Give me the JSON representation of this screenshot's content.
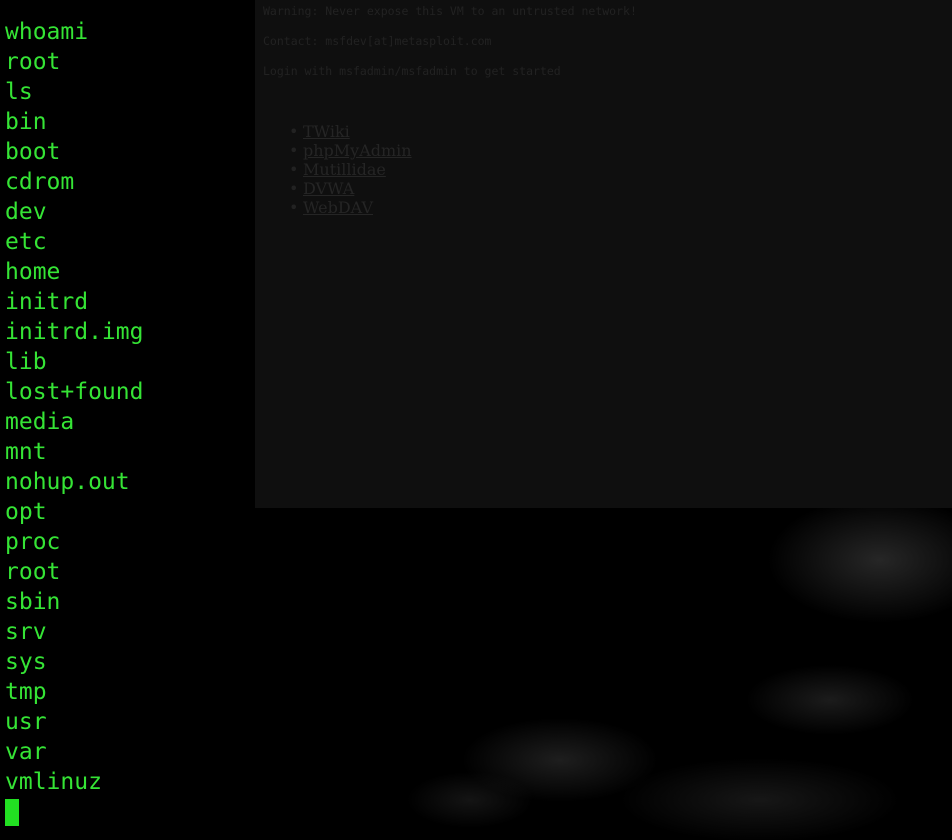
{
  "browser_page": {
    "warning": "Warning: Never expose this VM to an untrusted network!",
    "contact": "Contact: msfdev[at]metasploit.com",
    "login": "Login with msfadmin/msfadmin to get started",
    "links": [
      "TWiki",
      "phpMyAdmin",
      "Mutillidae",
      "DVWA",
      "WebDAV"
    ]
  },
  "terminal": {
    "lines": [
      "whoami",
      "root",
      "ls",
      "bin",
      "boot",
      "cdrom",
      "dev",
      "etc",
      "home",
      "initrd",
      "initrd.img",
      "lib",
      "lost+found",
      "media",
      "mnt",
      "nohup.out",
      "opt",
      "proc",
      "root",
      "sbin",
      "srv",
      "sys",
      "tmp",
      "usr",
      "var",
      "vmlinuz"
    ],
    "text_color": "#35e435"
  }
}
